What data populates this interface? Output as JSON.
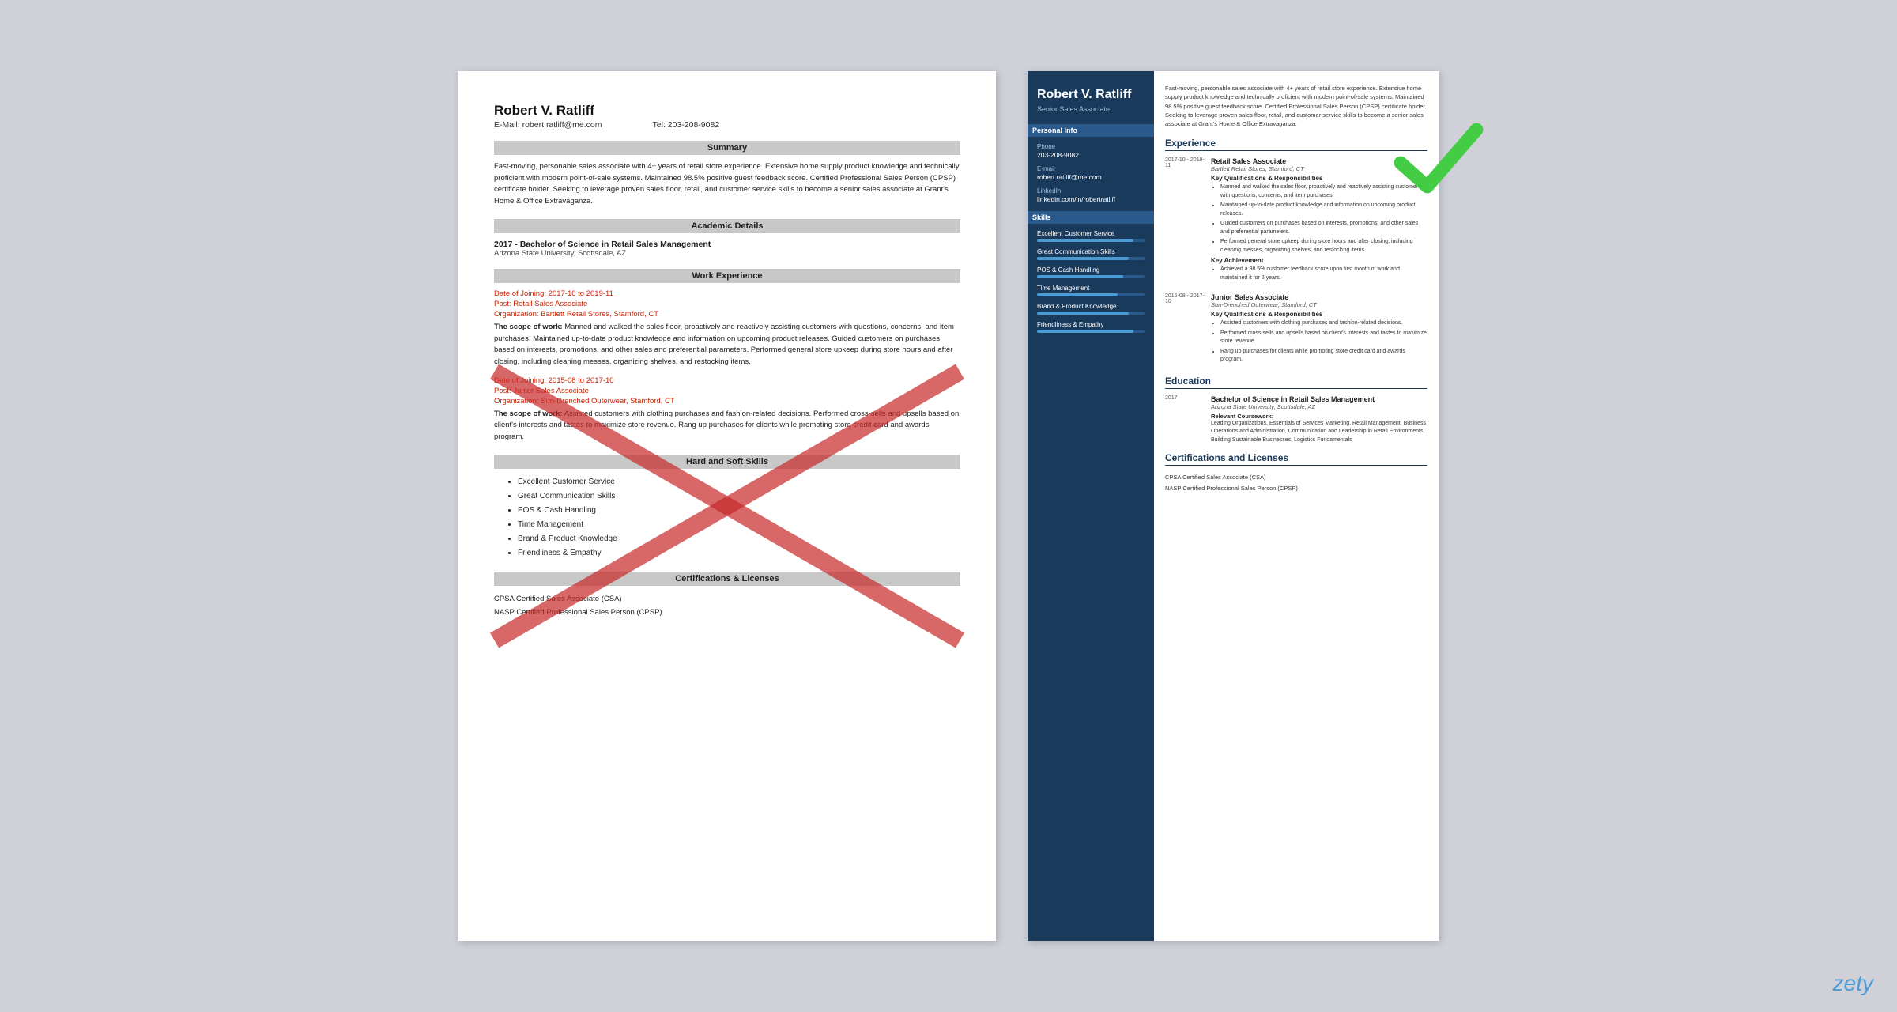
{
  "left_resume": {
    "name": "Robert V. Ratliff",
    "email_label": "E-Mail:",
    "email": "robert.ratliff@me.com",
    "tel_label": "Tel:",
    "tel": "203-208-9082",
    "sections": {
      "summary_title": "Summary",
      "summary_text": "Fast-moving, personable sales associate with 4+ years of retail store experience. Extensive home supply product knowledge and technically proficient with modern point-of-sale systems. Maintained 98.5% positive guest feedback score. Certified Professional Sales Person (CPSP) certificate holder. Seeking to leverage proven sales floor, retail, and customer service skills to become a senior sales associate at Grant's Home & Office Extravaganza.",
      "academic_title": "Academic Details",
      "degree": "2017 - Bachelor of Science in Retail Sales Management",
      "school": "Arizona State University, Scottsdale, AZ",
      "work_title": "Work Experience",
      "job1_dates": "Date of Joining: 2017-10 to 2019-11",
      "job1_post": "Post: Retail Sales Associate",
      "job1_org": "Organization: Bartlett Retail Stores, Stamford, CT",
      "job1_scope_label": "The scope of work:",
      "job1_scope": "Manned and walked the sales floor, proactively and reactively assisting customers with questions, concerns, and item purchases. Maintained up-to-date product knowledge and information on upcoming product releases. Guided customers on purchases based on interests, promotions, and other sales and preferential parameters. Performed general store upkeep during store hours and after closing, including cleaning messes, organizing shelves, and restocking items.",
      "job2_dates": "Date of Joining: 2015-08 to 2017-10",
      "job2_post": "Post: Junior Sales Associate",
      "job2_org": "Organization: Sun-Drenched Outerwear, Stamford, CT",
      "job2_scope_label": "The scope of work:",
      "job2_scope": "Assisted customers with clothing purchases and fashion-related decisions. Performed cross-sells and upsells based on client's interests and tastes to maximize store revenue. Rang up purchases for clients while promoting store credit card and awards program.",
      "skills_title": "Hard and Soft Skills",
      "skills": [
        "Excellent Customer Service",
        "Great Communication Skills",
        "POS & Cash Handling",
        "Time Management",
        "Brand & Product Knowledge",
        "Friendliness & Empathy"
      ],
      "certs_title": "Certifications & Licenses",
      "cert1": "CPSA Certified Sales Associate (CSA)",
      "cert2": "NASP Certified Professional Sales Person (CPSP)"
    }
  },
  "right_resume": {
    "name": "Robert V. Ratliff",
    "title": "Senior Sales Associate",
    "sidebar": {
      "personal_info_title": "Personal Info",
      "phone_label": "Phone",
      "phone": "203-208-9082",
      "email_label": "E-mail",
      "email": "robert.ratliff@me.com",
      "linkedin_label": "LinkedIn",
      "linkedin": "linkedin.com/in/robertratliff",
      "skills_title": "Skills",
      "skills": [
        {
          "name": "Excellent Customer Service",
          "pct": 90
        },
        {
          "name": "Great Communication Skills",
          "pct": 85
        },
        {
          "name": "POS & Cash Handling",
          "pct": 80
        },
        {
          "name": "Time Management",
          "pct": 75
        },
        {
          "name": "Brand & Product Knowledge",
          "pct": 85
        },
        {
          "name": "Friendliness & Empathy",
          "pct": 90
        }
      ]
    },
    "intro": "Fast-moving, personable sales associate with 4+ years of retail store experience. Extensive home supply product knowledge and technically proficient with modern point-of-sale systems. Maintained 98.5% positive guest feedback score. Certified Professional Sales Person (CPSP) certificate holder. Seeking to leverage proven sales floor, retail, and customer service skills to become a senior sales associate at Grant's Home & Office Extravaganza.",
    "experience_title": "Experience",
    "jobs": [
      {
        "dates": "2017-10 -\n2019-11",
        "title": "Retail Sales Associate",
        "org": "Bartlett Retail Stores, Stamford, CT",
        "kq_title": "Key Qualifications & Responsibilities",
        "bullets": [
          "Manned and walked the sales floor, proactively and reactively assisting customers with questions, concerns, and item purchases.",
          "Maintained up-to-date product knowledge and information on upcoming product releases.",
          "Guided customers on purchases based on interests, promotions, and other sales and preferential parameters.",
          "Performed general store upkeep during store hours and after closing, including cleaning messes, organizing shelves, and restocking items."
        ],
        "achievement_title": "Key Achievement",
        "achievement": "Achieved a 98.5% customer feedback score upon first month of work and maintained it for 2 years."
      },
      {
        "dates": "2015-08 -\n2017-10",
        "title": "Junior Sales Associate",
        "org": "Sun-Drenched Outerwear, Stamford, CT",
        "kq_title": "Key Qualifications & Responsibilities",
        "bullets": [
          "Assisted customers with clothing purchases and fashion-related decisions.",
          "Performed cross-sells and upsells based on client's interests and tastes to maximize store revenue.",
          "Rang up purchases for clients while promoting store credit card and awards program."
        ]
      }
    ],
    "education_title": "Education",
    "education": [
      {
        "year": "2017",
        "degree": "Bachelor of Science in Retail Sales Management",
        "school": "Arizona State University, Scottsdale, AZ",
        "coursework_label": "Relevant Coursework:",
        "coursework": "Leading Organizations, Essentials of Services Marketing, Retail Management, Business Operations and Administration, Communication and Leadership in Retail Environments, Building Sustainable Businesses, Logistics Fundamentals"
      }
    ],
    "certs_title": "Certifications and Licenses",
    "certs": [
      "CPSA Certified Sales Associate (CSA)",
      "NASP Certified Professional Sales Person (CPSP)"
    ]
  },
  "watermark": "zety"
}
